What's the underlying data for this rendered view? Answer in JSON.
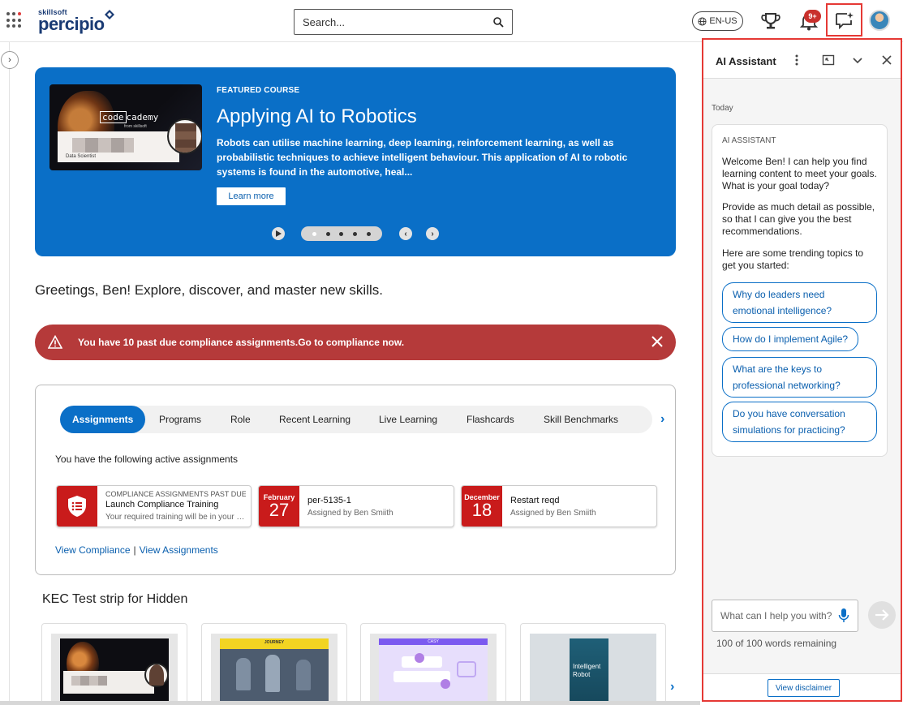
{
  "header": {
    "logo_small": "skillsoft",
    "logo_big": "percipio",
    "search_placeholder": "Search...",
    "language": "EN-US",
    "notification_count": "9+"
  },
  "hero": {
    "label": "FEATURED COURSE",
    "title": "Applying AI to Robotics",
    "description": "Robots can utilise machine learning, deep learning, reinforcement learning, as well as probabilistic techniques to achieve intelligent behaviour. This application of AI to robotic systems is found in the automotive, heal...",
    "cta": "Learn more",
    "thumb_brand_a": "code",
    "thumb_brand_b": "cademy",
    "thumb_from": "from skillsoft",
    "thumb_role": "Data Scientist"
  },
  "greeting": "Greetings, Ben! Explore, discover, and master new skills.",
  "alert": {
    "text": "You have 10 past due compliance assignments.Go to compliance now."
  },
  "assignments": {
    "tabs": [
      "Assignments",
      "Programs",
      "Role",
      "Recent Learning",
      "Live Learning",
      "Flashcards",
      "Skill Benchmarks"
    ],
    "intro": "You have the following active assignments",
    "cards": [
      {
        "sup": "COMPLIANCE ASSIGNMENTS PAST DUE",
        "title": "Launch Compliance Training",
        "sub": "Your required training will be in your learning"
      },
      {
        "month": "February",
        "day": "27",
        "title": "per-5135-1",
        "sub": "Assigned by Ben Smiith"
      },
      {
        "month": "December",
        "day": "18",
        "title": "Restart reqd",
        "sub": "Assigned by Ben Smiith"
      }
    ],
    "view_compliance": "View Compliance",
    "separator": "|",
    "view_assignments": "View Assignments"
  },
  "strip": {
    "title": "KEC Test strip for Hidden",
    "card2_label": "JOURNEY",
    "card3_label": "CASY",
    "card4_title_line1": "Intelligent",
    "card4_title_line2": "Robot"
  },
  "ai_assistant": {
    "title": "AI Assistant",
    "day_label": "Today",
    "sender": "AI ASSISTANT",
    "message_1": "Welcome Ben! I can help you find learning content to meet your goals. What is your goal today?",
    "message_2": "Provide as much detail as possible, so that I can give you the best recommendations.",
    "message_3": "Here are some trending topics to get you started:",
    "suggestions": [
      "Why do leaders need emotional intelligence?",
      "How do I implement Agile?",
      "What are the keys to professional networking?",
      "Do you have conversation simulations for practicing?"
    ],
    "input_placeholder": "What can I help you with?",
    "words_remaining": "100 of 100 words remaining",
    "disclaimer": "View disclaimer"
  },
  "colors": {
    "brand_blue": "#0a6fc7",
    "alert_red": "#b53a3a",
    "highlight_red": "#e53935",
    "card_red": "#c91b1b"
  }
}
